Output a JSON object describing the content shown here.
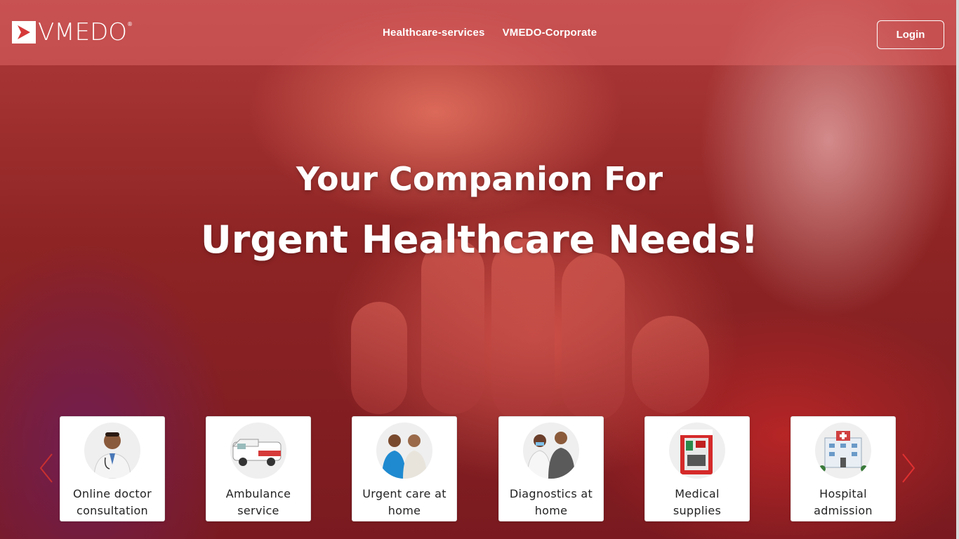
{
  "header": {
    "logo_text": "VMEDO",
    "logo_reg": "®",
    "nav": [
      "Healthcare-services",
      "VMEDO-Corporate"
    ],
    "login_label": "Login"
  },
  "hero": {
    "line1": "Your Companion For",
    "line2": "Urgent Healthcare Needs!"
  },
  "services": [
    {
      "label": "Online doctor consultation",
      "icon": "doctor-icon"
    },
    {
      "label": "Ambulance service",
      "icon": "ambulance-icon"
    },
    {
      "label": "Urgent care at home",
      "icon": "nurse-care-icon"
    },
    {
      "label": "Diagnostics at home",
      "icon": "diagnostics-icon"
    },
    {
      "label": "Medical supplies",
      "icon": "first-aid-kit-icon"
    },
    {
      "label": "Hospital admission",
      "icon": "hospital-icon"
    }
  ],
  "colors": {
    "accent": "#e03a3a",
    "header_bg": "#dc6464",
    "card_bg": "#ffffff"
  }
}
